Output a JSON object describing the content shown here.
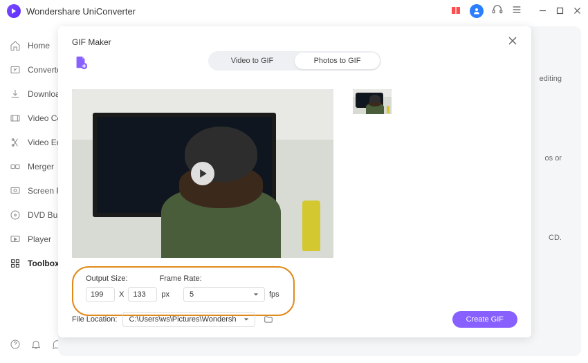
{
  "titlebar": {
    "app_name": "Wondershare UniConverter"
  },
  "sidebar": {
    "items": [
      {
        "key": "home",
        "label": "Home"
      },
      {
        "key": "converter",
        "label": "Converter"
      },
      {
        "key": "downloader",
        "label": "Downloader"
      },
      {
        "key": "video-compressor",
        "label": "Video Compressor"
      },
      {
        "key": "video-editor",
        "label": "Video Editor"
      },
      {
        "key": "merger",
        "label": "Merger"
      },
      {
        "key": "screen-recorder",
        "label": "Screen Recorder"
      },
      {
        "key": "dvd-burner",
        "label": "DVD Burner"
      },
      {
        "key": "player",
        "label": "Player"
      },
      {
        "key": "toolbox",
        "label": "Toolbox"
      }
    ],
    "active_index": 9
  },
  "background_hints": {
    "editing_text": "editing",
    "or_text": "os or",
    "cd_text": "CD."
  },
  "modal": {
    "title": "GIF Maker",
    "tabs": {
      "video": "Video to GIF",
      "photos": "Photos to GIF",
      "active": "photos"
    },
    "settings": {
      "output_size_label": "Output Size:",
      "width": "199",
      "height": "133",
      "unit": "px",
      "times": "X",
      "frame_rate_label": "Frame Rate:",
      "frame_rate": "5",
      "fps_unit": "fps"
    },
    "footer": {
      "file_location_label": "File Location:",
      "path": "C:\\Users\\ws\\Pictures\\Wondersh",
      "create_btn": "Create GIF"
    }
  }
}
